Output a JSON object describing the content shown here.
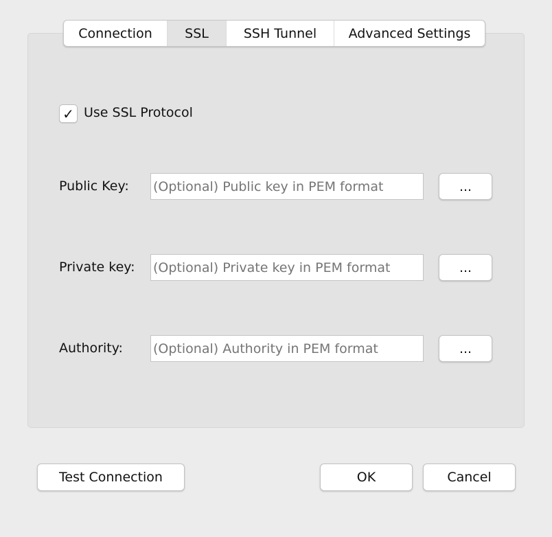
{
  "tabs": [
    {
      "label": "Connection",
      "active": false
    },
    {
      "label": "SSL",
      "active": true
    },
    {
      "label": "SSH Tunnel",
      "active": false
    },
    {
      "label": "Advanced Settings",
      "active": false
    }
  ],
  "ssl": {
    "use_ssl_label": "Use SSL Protocol",
    "use_ssl_checked": true,
    "check_glyph": "✓",
    "fields": [
      {
        "label": "Public Key:",
        "placeholder": "(Optional) Public key in PEM format",
        "value": "",
        "browse_label": "..."
      },
      {
        "label": "Private key:",
        "placeholder": "(Optional) Private key in PEM format",
        "value": "",
        "browse_label": "..."
      },
      {
        "label": "Authority:",
        "placeholder": "(Optional) Authority in PEM format",
        "value": "",
        "browse_label": "..."
      }
    ]
  },
  "footer": {
    "test_label": "Test Connection",
    "ok_label": "OK",
    "cancel_label": "Cancel"
  }
}
